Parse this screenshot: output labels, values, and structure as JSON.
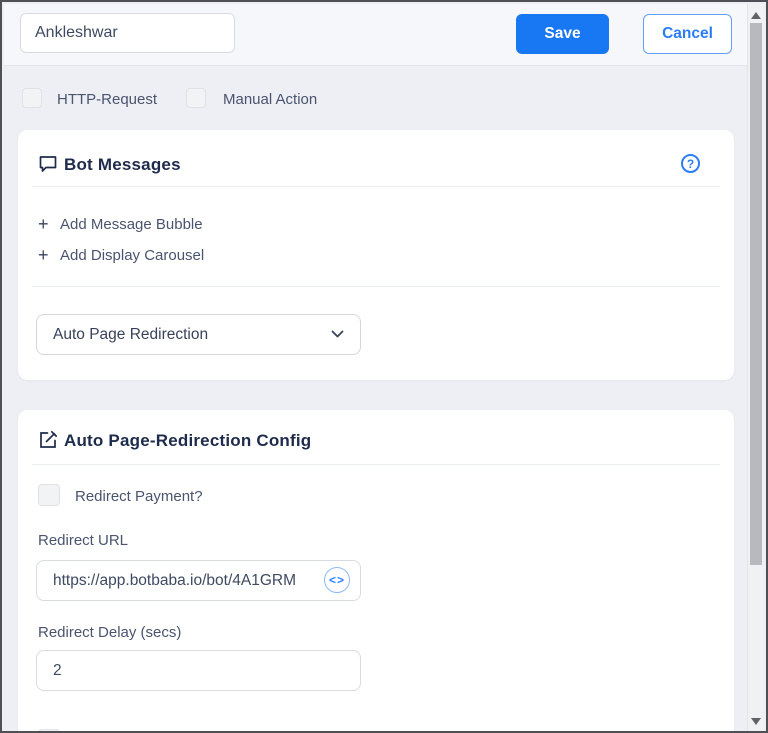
{
  "colors": {
    "accent_blue": "#1877f2",
    "heading_navy": "#1f2b4c",
    "label_gray": "#4a546e",
    "page_bg": "#edeff4"
  },
  "topbar": {
    "name_input": {
      "value": "Ankleshwar"
    },
    "save_label": "Save",
    "cancel_label": "Cancel"
  },
  "toggles": {
    "http_request_label": "HTTP-Request",
    "manual_action_label": "Manual Action"
  },
  "bot_messages_card": {
    "title": "Bot Messages",
    "help_glyph": "?",
    "plus_glyph": "+",
    "add_message_bubble_label": "Add Message Bubble",
    "add_display_carousel_label": "Add Display Carousel",
    "message_type_select": {
      "selected": "Auto Page Redirection"
    }
  },
  "redirect_card": {
    "title": "Auto Page-Redirection Config",
    "redirect_payment_label": "Redirect Payment?",
    "redirect_url_label": "Redirect URL",
    "redirect_url_input": {
      "value": "https://app.botbaba.io/bot/4A1GRM"
    },
    "code_glyph": "<>",
    "redirect_delay_label": "Redirect Delay (secs)",
    "redirect_delay_input": {
      "value": "2"
    }
  }
}
